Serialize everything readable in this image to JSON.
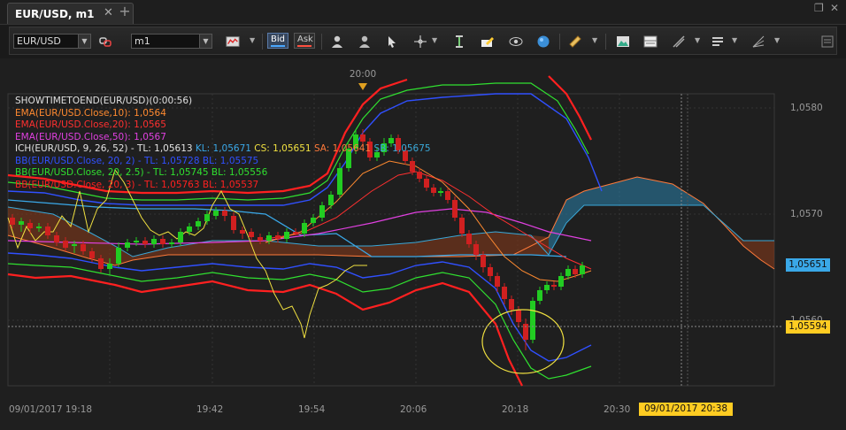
{
  "window": {
    "tab_title": "EUR/USD, m1",
    "tab_close": "✕",
    "tab_add": "+",
    "restore": "❐",
    "close": "✕"
  },
  "toolbar": {
    "symbol": "EUR/USD",
    "timeframe": "m1",
    "bid_label": "Bid",
    "ask_label": "Ask",
    "icons": [
      "chart-type-icon",
      "person-icon",
      "person-alt-icon",
      "cursor-icon",
      "crosshair-icon",
      "text-tool-icon",
      "pencil-icon",
      "eye-icon",
      "globe-icon",
      "ruler-icon",
      "landscape-icon",
      "panels-icon",
      "lines-icon",
      "list-icon",
      "fan-icon",
      "menu-icon"
    ]
  },
  "chart": {
    "top_time_label": "20:00",
    "legend": [
      {
        "text": "SHOWTIMETOEND(EUR/USD)(0:00:56)",
        "color": "#e0e0e0"
      },
      {
        "text": "EMA(EUR/USD.Close,10): 1,0564",
        "color": "#ff8a30"
      },
      {
        "text": "EMA(EUR/USD.Close,20): 1,0565",
        "color": "#ff3030"
      },
      {
        "text": "EMA(EUR/USD.Close,50): 1,0567",
        "color": "#e040e0"
      }
    ],
    "ich": {
      "name": "ICH(EUR/USD, 9, 26, 52) -",
      "tl": "TL: 1,05613",
      "kl": "KL: 1,05671",
      "cs": "CS: 1,05651",
      "sa": "SA: 1,05641",
      "sb": "SB: 1,05675"
    },
    "bb_lines": [
      {
        "text": "BB(EUR/USD.Close, 20, 2) -  TL: 1,05728  BL: 1,05575",
        "color": "#3050ff"
      },
      {
        "text": "BB(EUR/USD.Close, 20, 2.5) -  TL: 1,05745  BL: 1,05556",
        "color": "#30e030"
      },
      {
        "text": "BB(EUR/USD.Close, 20, 3) -  TL: 1,05763  BL: 1,05537",
        "color": "#ff2020"
      }
    ],
    "price_axis": [
      "1,0580",
      "1,0570",
      "1,0560"
    ],
    "price_tag_current": "1,05651",
    "price_tag_cursor": "1,05594",
    "time_axis": [
      "09/01/2017 19:18",
      "19:42",
      "19:54",
      "20:06",
      "20:18",
      "20:30"
    ],
    "time_cursor": "09/01/2017 20:38"
  }
}
